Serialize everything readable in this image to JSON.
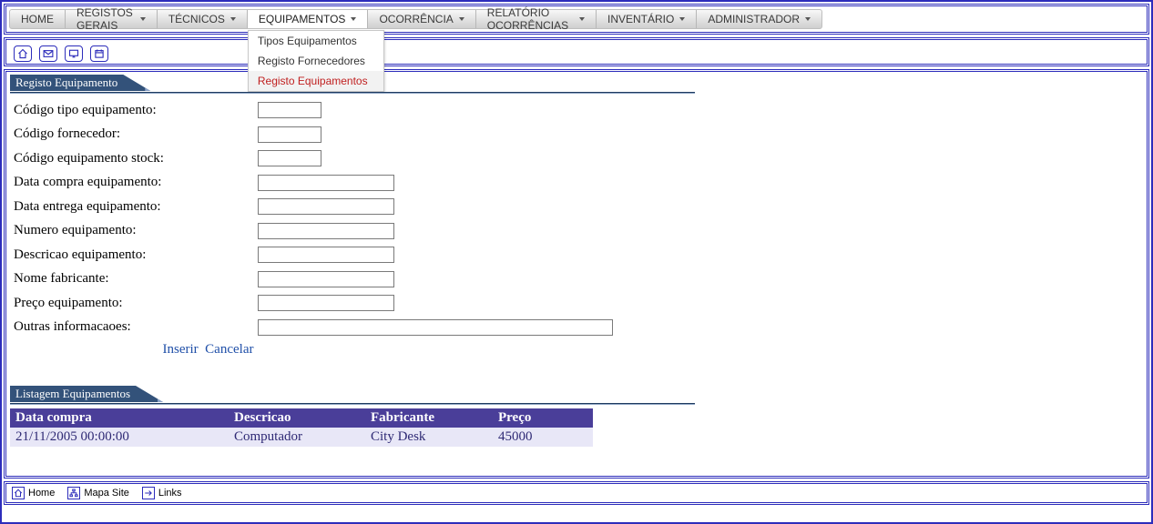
{
  "nav": {
    "items": [
      {
        "label": "HOME"
      },
      {
        "label": "REGISTOS GERAIS",
        "has_sub": true
      },
      {
        "label": "TÉCNICOS",
        "has_sub": true
      },
      {
        "label": "EQUIPAMENTOS",
        "has_sub": true,
        "active": true
      },
      {
        "label": "OCORRÊNCIA",
        "has_sub": true
      },
      {
        "label": "RELATÓRIO OCORRÊNCIAS",
        "has_sub": true
      },
      {
        "label": "INVENTÁRIO",
        "has_sub": true
      },
      {
        "label": "ADMINISTRADOR",
        "has_sub": true
      }
    ],
    "dropdown": {
      "items": [
        {
          "label": "Tipos Equipamentos"
        },
        {
          "label": "Registo Fornecedores"
        },
        {
          "label": "Registo Equipamentos",
          "current": true
        }
      ]
    }
  },
  "sections": {
    "form_title": "Registo Equipamento",
    "list_title": "Listagem Equipamentos"
  },
  "form": {
    "fields": [
      {
        "label": "Código tipo equipamento:",
        "size": "s",
        "name": "codigo-tipo-equipamento"
      },
      {
        "label": "Código fornecedor:",
        "size": "s",
        "name": "codigo-fornecedor"
      },
      {
        "label": "Código equipamento stock:",
        "size": "s",
        "name": "codigo-equipamento-stock"
      },
      {
        "label": "Data compra equipamento:",
        "size": "m",
        "name": "data-compra"
      },
      {
        "label": "Data entrega equipamento:",
        "size": "m",
        "name": "data-entrega"
      },
      {
        "label": "Numero equipamento:",
        "size": "m",
        "name": "numero-equipamento"
      },
      {
        "label": "Descricao equipamento:",
        "size": "m",
        "name": "descricao-equipamento"
      },
      {
        "label": "Nome fabricante:",
        "size": "m",
        "name": "nome-fabricante"
      },
      {
        "label": "Preço equipamento:",
        "size": "m",
        "name": "preco-equipamento"
      },
      {
        "label": "Outras informacaoes:",
        "size": "l",
        "name": "outras-informacoes"
      }
    ],
    "actions": {
      "insert": "Inserir",
      "cancel": "Cancelar"
    }
  },
  "list": {
    "headers": [
      "Data compra",
      "Descricao",
      "Fabricante",
      "Preço"
    ],
    "rows": [
      {
        "data": "21/11/2005 00:00:00",
        "descricao": "Computador",
        "fabricante": "City Desk",
        "preco": "45000"
      }
    ]
  },
  "footer": {
    "home": "Home",
    "map": "Mapa Site",
    "links": "Links"
  }
}
